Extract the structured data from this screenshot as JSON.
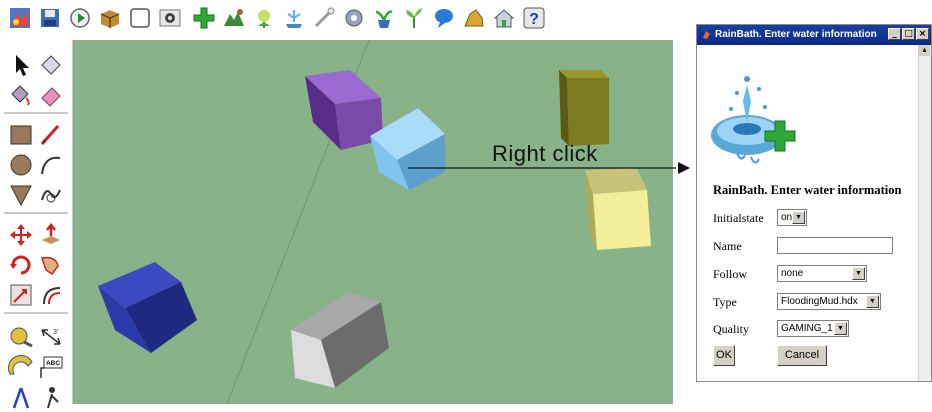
{
  "annotation": {
    "label": "Right click"
  },
  "dialog": {
    "window_title": "RainBath. Enter water information",
    "heading": "RainBath. Enter water information",
    "controls": {
      "minimize": "_",
      "maximize": "□",
      "close": "×"
    },
    "fields": {
      "initialstate": {
        "label": "Initialstate",
        "value": "on"
      },
      "name": {
        "label": "Name",
        "value": ""
      },
      "follow": {
        "label": "Follow",
        "value": "none"
      },
      "type": {
        "label": "Type",
        "value": "FloodingMud.hdx"
      },
      "quality": {
        "label": "Quality",
        "value": "GAMING_1"
      }
    },
    "buttons": {
      "ok": "OK",
      "cancel": "Cancel"
    }
  },
  "left_toolbar": {
    "text_tool_label": "ABC"
  },
  "colors": {
    "viewport": "#88b287",
    "box_purple": "#7a4aa8",
    "box_lightblue": "#7ec4ec",
    "box_olive": "#7e7a1e",
    "box_yellow": "#f2ee9a",
    "box_navy": "#2a3aa8",
    "box_white": "#dcdcdc",
    "cross_green": "#2ea836"
  }
}
